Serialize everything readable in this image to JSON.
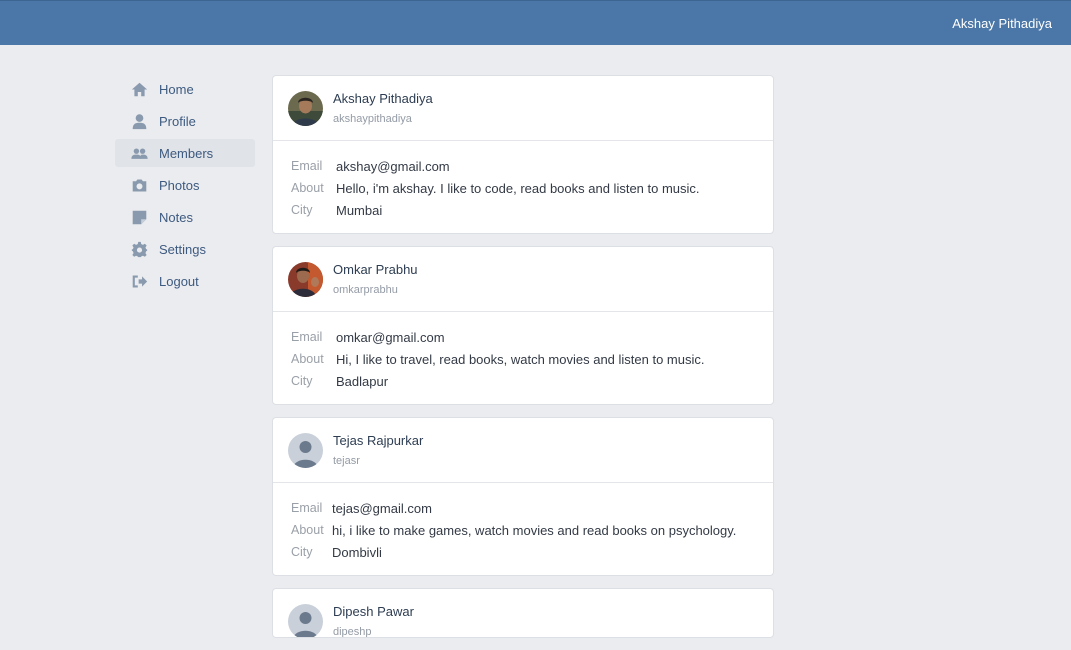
{
  "header": {
    "user_name": "Akshay Pithadiya"
  },
  "sidebar": {
    "items": [
      {
        "label": "Home",
        "icon": "home-icon"
      },
      {
        "label": "Profile",
        "icon": "user-icon"
      },
      {
        "label": "Members",
        "icon": "users-icon",
        "active": true
      },
      {
        "label": "Photos",
        "icon": "camera-icon"
      },
      {
        "label": "Notes",
        "icon": "note-icon"
      },
      {
        "label": "Settings",
        "icon": "gear-icon"
      },
      {
        "label": "Logout",
        "icon": "logout-icon"
      }
    ]
  },
  "labels": {
    "email": "Email",
    "about": "About",
    "city": "City"
  },
  "members": [
    {
      "name": "Akshay Pithadiya",
      "handle": "akshaypithadiya",
      "email": "akshay@gmail.com",
      "about": "Hello, i'm akshay. I like to code, read books and listen to music.",
      "city": "Mumbai"
    },
    {
      "name": "Omkar Prabhu",
      "handle": "omkarprabhu",
      "email": "omkar@gmail.com",
      "about": "Hi, I like to travel, read books, watch movies and listen to music.",
      "city": "Badlapur"
    },
    {
      "name": "Tejas Rajpurkar",
      "handle": "tejasr",
      "email": "tejas@gmail.com",
      "about": "hi, i like to make games, watch movies and read books on psychology.",
      "city": "Dombivli"
    },
    {
      "name": "Dipesh Pawar",
      "handle": "dipeshp"
    }
  ],
  "colors": {
    "topbar": "#4a76a8",
    "background": "#ebecef",
    "accent_text": "#3d5a80"
  }
}
